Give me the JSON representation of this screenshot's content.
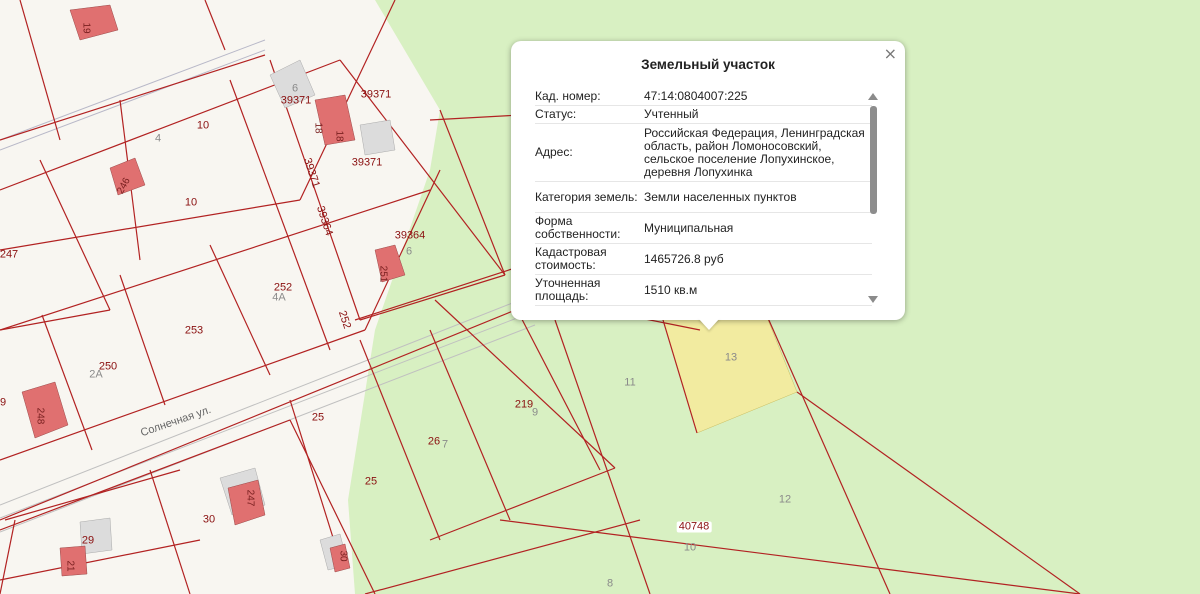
{
  "popup": {
    "title": "Земельный участок",
    "close_glyph": "×",
    "rows": [
      {
        "key": "Кад. номер:",
        "value": "47:14:0804007:225"
      },
      {
        "key": "Статус:",
        "value": "Учтенный"
      },
      {
        "key": "Адрес:",
        "value": "Российская Федерация, Ленинградская область, район Ломоносовский, сельское поселение Лопухинское, деревня Лопухинка"
      },
      {
        "key": "Категория земель:",
        "value": "Земли населенных пунктов"
      },
      {
        "key": "Форма собственности:",
        "value": "Муниципальная"
      },
      {
        "key": "Кадастровая стоимость:",
        "value": "1465726.8 руб"
      },
      {
        "key": "Уточненная площадь:",
        "value": "1510 кв.м"
      }
    ]
  },
  "map": {
    "colors": {
      "background": "#f8f6f1",
      "forest": "#d8f0c2",
      "boundary": "#b22222",
      "building": "#e07070",
      "building_grey": "#dcdcdc",
      "selected_parcel": "#f2eba0"
    },
    "street_name": "Солнечная ул.",
    "labels": [
      {
        "text": "19"
      },
      {
        "text": "6"
      },
      {
        "text": "39371"
      },
      {
        "text": "39371"
      },
      {
        "text": "18"
      },
      {
        "text": "18"
      },
      {
        "text": "39371"
      },
      {
        "text": "39371"
      },
      {
        "text": "4"
      },
      {
        "text": "10"
      },
      {
        "text": "10"
      },
      {
        "text": "246"
      },
      {
        "text": "39364"
      },
      {
        "text": "39364"
      },
      {
        "text": "6"
      },
      {
        "text": "251"
      },
      {
        "text": "252"
      },
      {
        "text": "4А"
      },
      {
        "text": "252"
      },
      {
        "text": "253"
      },
      {
        "text": "247"
      },
      {
        "text": "250"
      },
      {
        "text": "2А"
      },
      {
        "text": "248"
      },
      {
        "text": "9"
      },
      {
        "text": "25"
      },
      {
        "text": "26"
      },
      {
        "text": "7"
      },
      {
        "text": "219"
      },
      {
        "text": "9"
      },
      {
        "text": "11"
      },
      {
        "text": "13"
      },
      {
        "text": "12"
      },
      {
        "text": "25"
      },
      {
        "text": "30"
      },
      {
        "text": "247"
      },
      {
        "text": "29"
      },
      {
        "text": "21"
      },
      {
        "text": "30"
      },
      {
        "text": "40748"
      },
      {
        "text": "10"
      },
      {
        "text": "8"
      }
    ]
  }
}
